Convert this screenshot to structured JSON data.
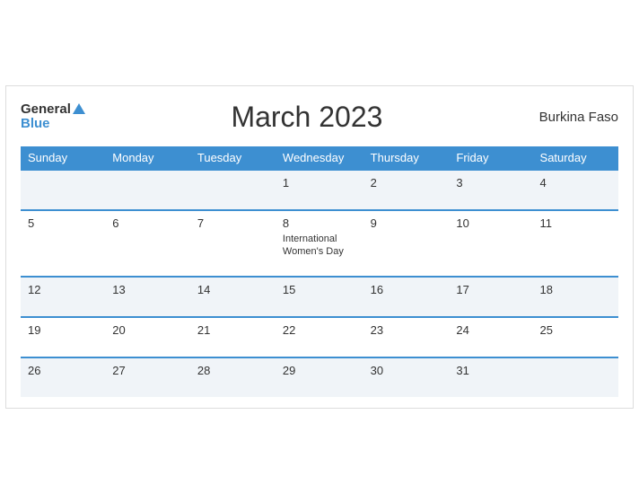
{
  "header": {
    "title": "March 2023",
    "country": "Burkina Faso",
    "logo_general": "General",
    "logo_blue": "Blue"
  },
  "weekdays": [
    "Sunday",
    "Monday",
    "Tuesday",
    "Wednesday",
    "Thursday",
    "Friday",
    "Saturday"
  ],
  "weeks": [
    [
      {
        "day": "",
        "event": ""
      },
      {
        "day": "",
        "event": ""
      },
      {
        "day": "",
        "event": ""
      },
      {
        "day": "1",
        "event": ""
      },
      {
        "day": "2",
        "event": ""
      },
      {
        "day": "3",
        "event": ""
      },
      {
        "day": "4",
        "event": ""
      }
    ],
    [
      {
        "day": "5",
        "event": ""
      },
      {
        "day": "6",
        "event": ""
      },
      {
        "day": "7",
        "event": ""
      },
      {
        "day": "8",
        "event": "International Women's Day"
      },
      {
        "day": "9",
        "event": ""
      },
      {
        "day": "10",
        "event": ""
      },
      {
        "day": "11",
        "event": ""
      }
    ],
    [
      {
        "day": "12",
        "event": ""
      },
      {
        "day": "13",
        "event": ""
      },
      {
        "day": "14",
        "event": ""
      },
      {
        "day": "15",
        "event": ""
      },
      {
        "day": "16",
        "event": ""
      },
      {
        "day": "17",
        "event": ""
      },
      {
        "day": "18",
        "event": ""
      }
    ],
    [
      {
        "day": "19",
        "event": ""
      },
      {
        "day": "20",
        "event": ""
      },
      {
        "day": "21",
        "event": ""
      },
      {
        "day": "22",
        "event": ""
      },
      {
        "day": "23",
        "event": ""
      },
      {
        "day": "24",
        "event": ""
      },
      {
        "day": "25",
        "event": ""
      }
    ],
    [
      {
        "day": "26",
        "event": ""
      },
      {
        "day": "27",
        "event": ""
      },
      {
        "day": "28",
        "event": ""
      },
      {
        "day": "29",
        "event": ""
      },
      {
        "day": "30",
        "event": ""
      },
      {
        "day": "31",
        "event": ""
      },
      {
        "day": "",
        "event": ""
      }
    ]
  ],
  "colors": {
    "header_bg": "#3d8fd1",
    "accent": "#3d8fd1"
  }
}
